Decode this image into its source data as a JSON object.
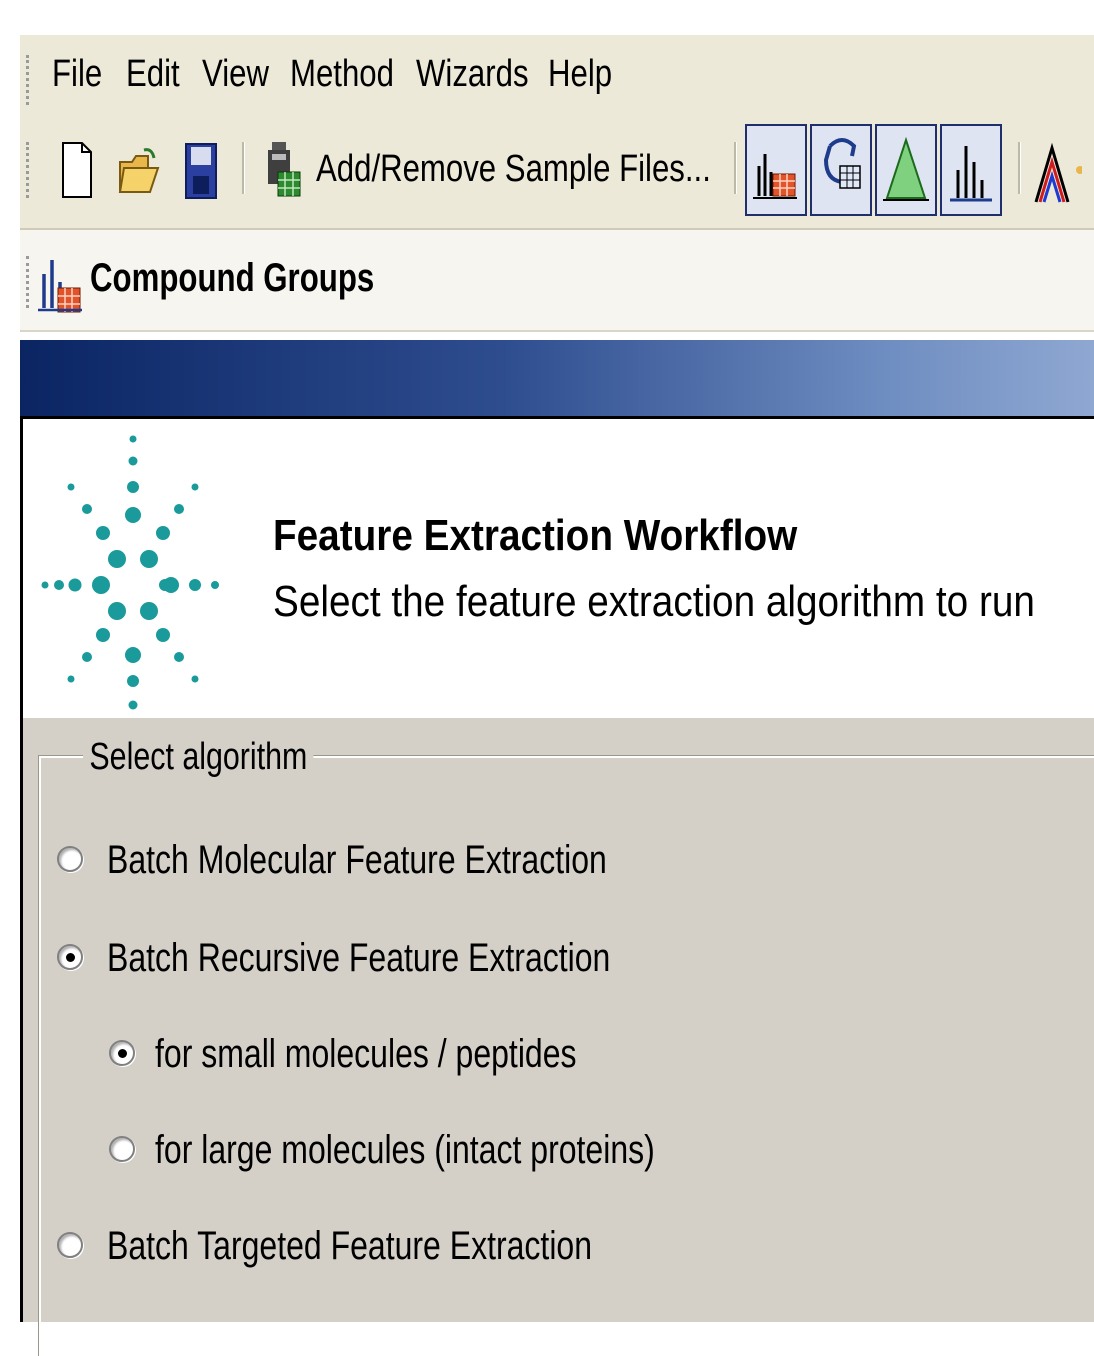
{
  "menu": {
    "items": [
      "File",
      "Edit",
      "View",
      "Method",
      "Wizards",
      "Help"
    ]
  },
  "toolbar": {
    "add_remove_label": "Add/Remove Sample Files...",
    "icons": [
      "new-file-icon",
      "open-folder-icon",
      "save-icon",
      "sample-files-icon",
      "compound-table-icon",
      "recursive-table-icon",
      "peak-icon",
      "spectrum-icon",
      "chromatogram-icon"
    ]
  },
  "compound_groups": {
    "label": "Compound Groups"
  },
  "wizard": {
    "title": "Feature Extraction Workflow",
    "subtitle": "Select the feature extraction algorithm to run"
  },
  "algorithm": {
    "legend": "Select algorithm",
    "options": [
      {
        "label": "Batch Molecular Feature Extraction",
        "selected": false
      },
      {
        "label": "Batch Recursive Feature Extraction",
        "selected": true
      },
      {
        "label": "for small molecules / peptides",
        "selected": true
      },
      {
        "label": "for large molecules (intact proteins)",
        "selected": false
      },
      {
        "label": "Batch Targeted Feature Extraction",
        "selected": false
      }
    ]
  },
  "colors": {
    "header_dark": "#0b2563",
    "header_light": "#8fa8d2",
    "panel_bg": "#d4d0c8",
    "logo_teal": "#1a9a9a"
  }
}
